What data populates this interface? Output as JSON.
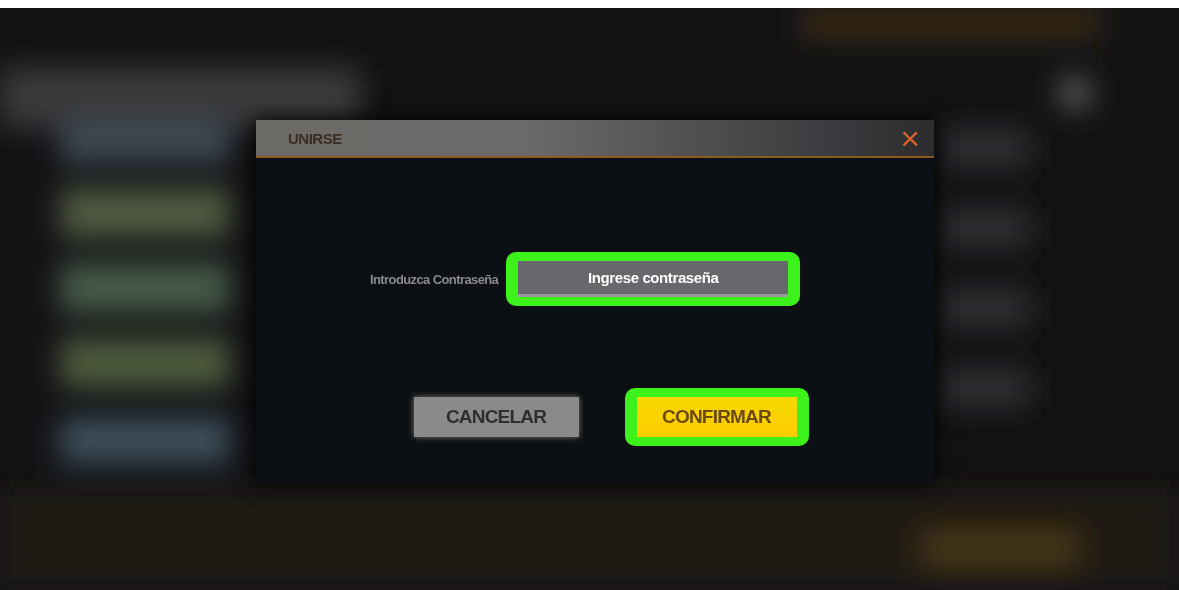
{
  "dialog": {
    "title": "UNIRSE",
    "close": "×",
    "password": {
      "label": "Introduzca Contraseña",
      "placeholder": "Ingrese contraseña",
      "highlighted": true
    },
    "buttons": [
      {
        "kind": "secondary",
        "label": "CANCELAR",
        "highlighted": false
      },
      {
        "kind": "primary",
        "label": "CONFIRMAR",
        "highlighted": true
      }
    ]
  }
}
